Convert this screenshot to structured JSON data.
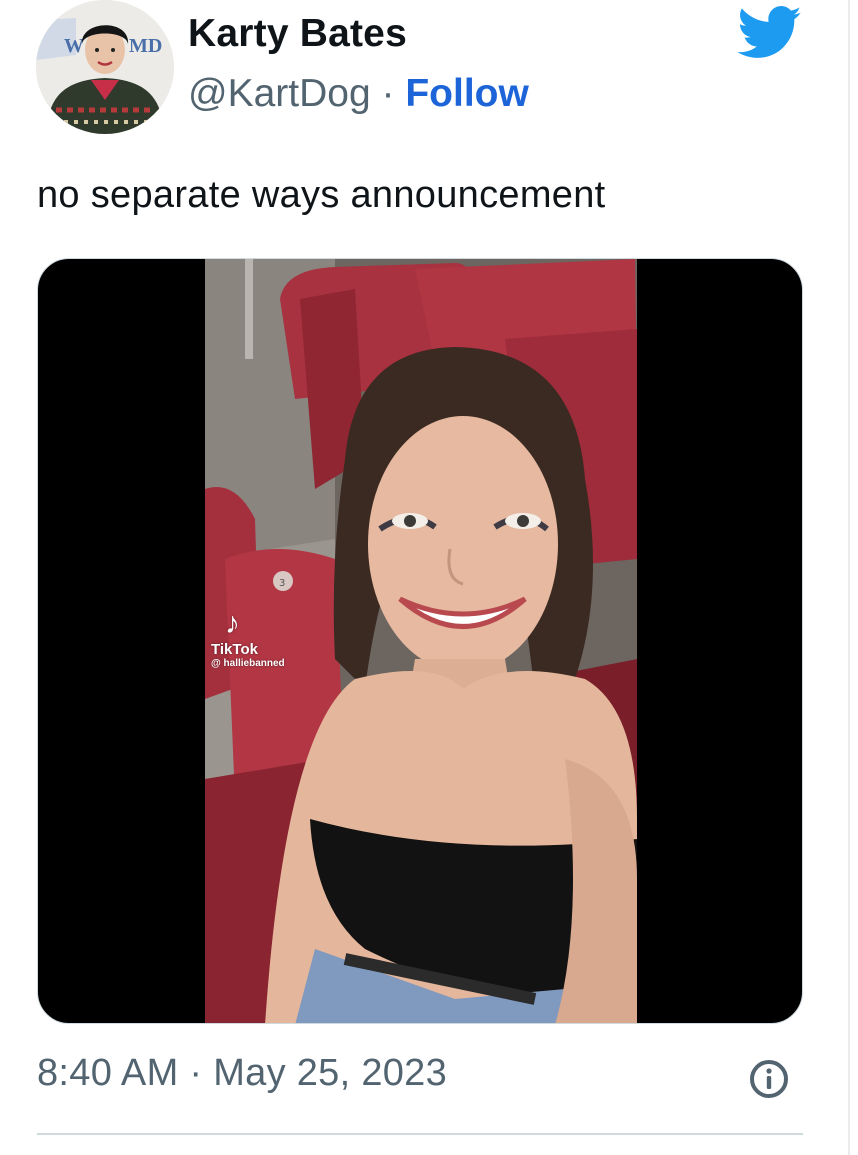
{
  "author": {
    "display_name": "Karty Bates",
    "handle": "@KartDog",
    "separator": " · ",
    "follow_label": "Follow"
  },
  "tweet": {
    "text": "no separate ways announcement",
    "timestamp": "8:40 AM · May 25, 2023"
  },
  "media": {
    "watermark_brand": "TikTok",
    "watermark_user": "@ halliebanned",
    "seat_number": "3"
  },
  "colors": {
    "brand_blue": "#1d9bf0",
    "follow_link": "#1d64d9",
    "secondary_text": "#536471",
    "border": "#cfd9de"
  },
  "icons": {
    "logo": "twitter-bird-icon",
    "info": "info-icon",
    "tiktok": "tiktok-note-icon"
  }
}
